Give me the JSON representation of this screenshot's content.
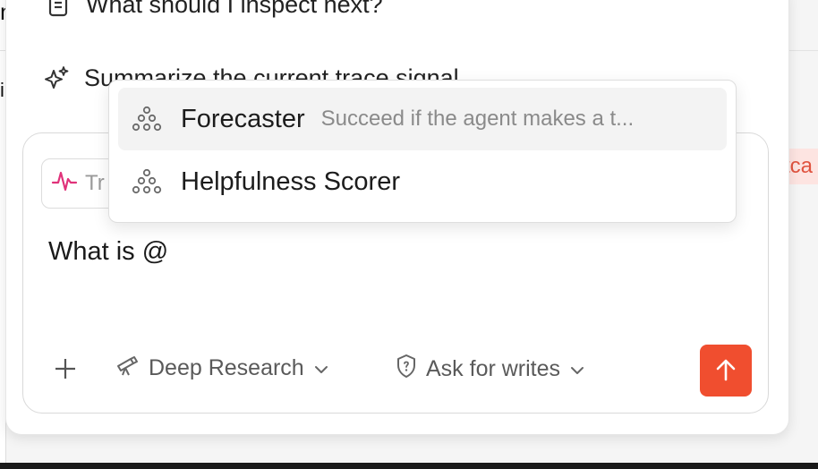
{
  "background": {
    "left_fragment_top": "n",
    "left_fragment_mid": "i",
    "right_tag_text": "tca"
  },
  "suggestions": [
    {
      "icon": "document-icon",
      "label": "What should I inspect next?"
    },
    {
      "icon": "sparkles-icon",
      "label": "Summarize the current trace signal"
    }
  ],
  "composer": {
    "context_chip": {
      "icon": "activity-icon",
      "label": "Tr"
    },
    "input_value": "What is @",
    "toolbar": {
      "add_icon": "plus-icon",
      "research_mode": {
        "icon": "telescope-icon",
        "label": "Deep Research"
      },
      "permission_mode": {
        "icon": "shield-icon",
        "label": "Ask for writes"
      },
      "send_icon": "arrow-up-icon"
    }
  },
  "mention_dropdown": {
    "items": [
      {
        "icon": "scorer-icon",
        "name": "Forecaster",
        "description": "Succeed if the agent makes a t...",
        "active": true
      },
      {
        "icon": "scorer-icon",
        "name": "Helpfulness Scorer",
        "description": "",
        "active": false
      }
    ]
  },
  "colors": {
    "accent": "#f04e2f",
    "activity_icon": "#e0327a",
    "tag_bg": "#fde4e1"
  }
}
